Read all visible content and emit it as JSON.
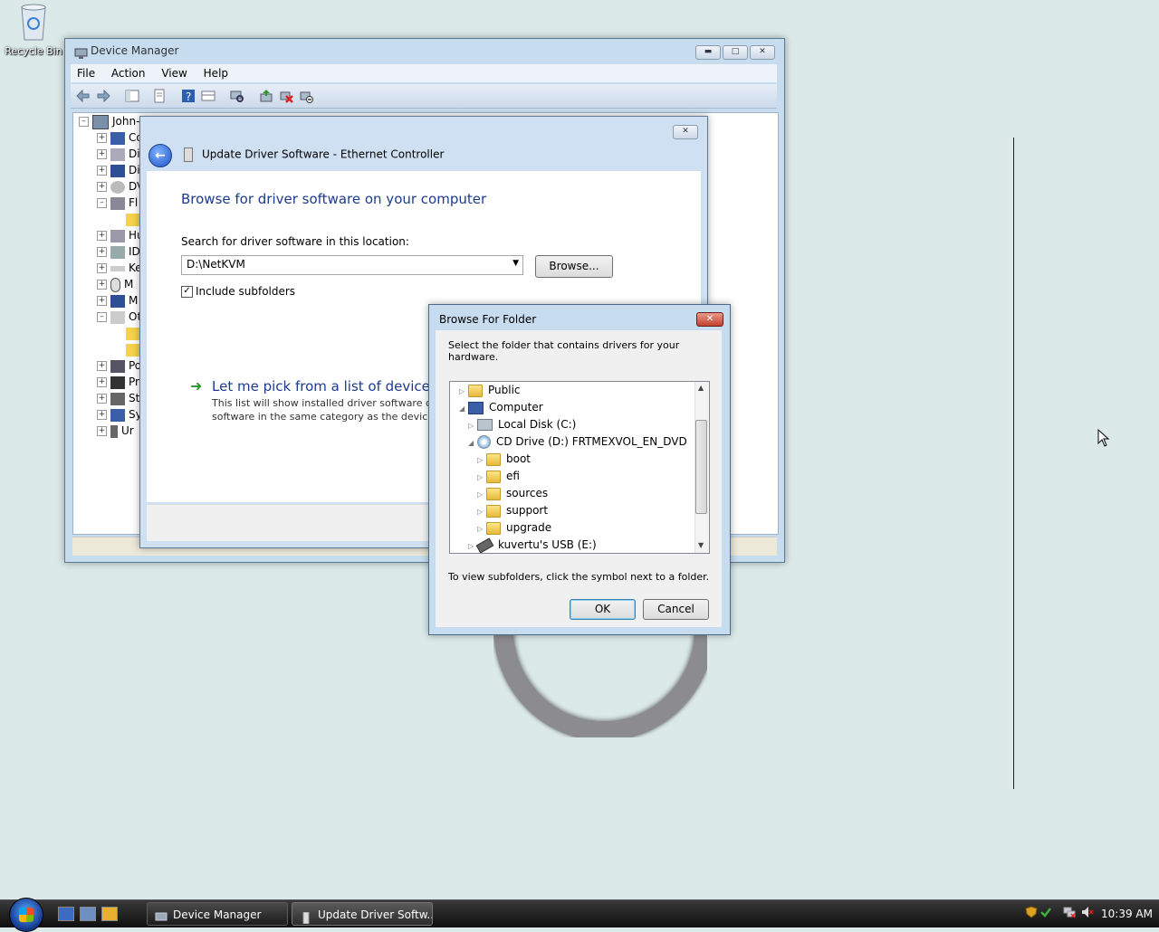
{
  "desktop": {
    "recycle_bin_label": "Recycle Bin"
  },
  "device_manager": {
    "title": "Device Manager",
    "menu": [
      "File",
      "Action",
      "View",
      "Help"
    ],
    "tree": {
      "root": "John-",
      "items": [
        "Co",
        "Di",
        "Di",
        "DV",
        "Fl",
        "",
        "Hu",
        "ID",
        "Ke",
        "M",
        "M",
        "Ot",
        "",
        "",
        "Po",
        "Pr",
        "St",
        "Sy",
        "Ur"
      ]
    }
  },
  "update_driver": {
    "window_title": "Update Driver Software - Ethernet Controller",
    "heading": "Browse for driver software on your computer",
    "search_label": "Search for driver software in this location:",
    "location_value": "D:\\NetKVM",
    "browse_button": "Browse...",
    "include_subfolders_label": "Include subfolders",
    "include_subfolders_checked": true,
    "pick_title": "Let me pick from a list of device dri",
    "pick_desc_line1": "This list will show installed driver software cor",
    "pick_desc_line2": "software in the same category as the device."
  },
  "browse_folder": {
    "title": "Browse For Folder",
    "instruction": "Select the folder that contains drivers for your hardware.",
    "tree": [
      {
        "label": "Public",
        "icon": "folder-icon",
        "expander": "collapsed"
      },
      {
        "label": "Computer",
        "icon": "computer-icon",
        "expander": "expanded"
      },
      {
        "label": "Local Disk (C:)",
        "icon": "hard-drive-icon",
        "expander": "collapsed"
      },
      {
        "label": "CD Drive (D:) FRTMEXVOL_EN_DVD",
        "icon": "cd-drive-icon",
        "expander": "expanded"
      },
      {
        "label": "boot",
        "icon": "folder-icon",
        "expander": "collapsed"
      },
      {
        "label": "efi",
        "icon": "folder-icon",
        "expander": "collapsed"
      },
      {
        "label": "sources",
        "icon": "folder-icon",
        "expander": "collapsed"
      },
      {
        "label": "support",
        "icon": "folder-icon",
        "expander": "collapsed"
      },
      {
        "label": "upgrade",
        "icon": "folder-icon",
        "expander": "collapsed"
      },
      {
        "label": "kuvertu's USB (E:)",
        "icon": "usb-drive-icon",
        "expander": "collapsed"
      }
    ],
    "hint": "To view subfolders, click the symbol next to a folder.",
    "ok_button": "OK",
    "cancel_button": "Cancel"
  },
  "taskbar": {
    "tasks": [
      "Device Manager",
      "Update Driver Softw..."
    ],
    "clock": "10:39 AM"
  }
}
